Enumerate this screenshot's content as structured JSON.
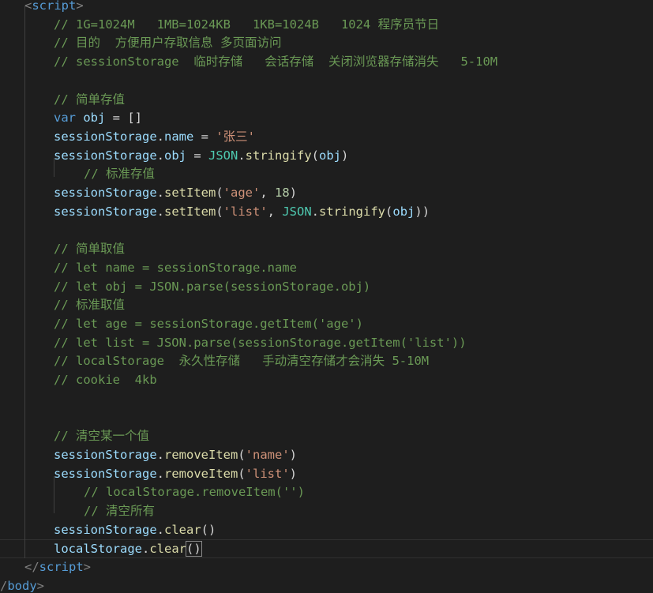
{
  "editor": {
    "lines": [
      {
        "indent": 1,
        "tokens": [
          [
            "t-bracket",
            "<"
          ],
          [
            "t-tag",
            "script"
          ],
          [
            "t-bracket",
            ">"
          ]
        ]
      },
      {
        "indent": 2,
        "tokens": [
          [
            "t-comment",
            "// 1G=1024M   1MB=1024KB   1KB=1024B   1024 程序员节日"
          ]
        ]
      },
      {
        "indent": 2,
        "tokens": [
          [
            "t-comment",
            "// 目的  方便用户存取信息 多页面访问"
          ]
        ]
      },
      {
        "indent": 2,
        "tokens": [
          [
            "t-comment",
            "// sessionStorage  临时存储   会话存储  关闭浏览器存储消失   5-10M"
          ]
        ]
      },
      {
        "indent": 0,
        "tokens": []
      },
      {
        "indent": 2,
        "tokens": [
          [
            "t-comment",
            "// 简单存值"
          ]
        ]
      },
      {
        "indent": 2,
        "tokens": [
          [
            "t-keyword",
            "var"
          ],
          [
            "t-punc",
            " "
          ],
          [
            "t-var",
            "obj"
          ],
          [
            "t-punc",
            " = []"
          ]
        ]
      },
      {
        "indent": 2,
        "tokens": [
          [
            "t-var",
            "sessionStorage"
          ],
          [
            "t-punc",
            "."
          ],
          [
            "t-prop",
            "name"
          ],
          [
            "t-punc",
            " = "
          ],
          [
            "t-str",
            "'张三'"
          ]
        ]
      },
      {
        "indent": 2,
        "tokens": [
          [
            "t-var",
            "sessionStorage"
          ],
          [
            "t-punc",
            "."
          ],
          [
            "t-prop",
            "obj"
          ],
          [
            "t-punc",
            " = "
          ],
          [
            "t-const",
            "JSON"
          ],
          [
            "t-punc",
            "."
          ],
          [
            "t-func",
            "stringify"
          ],
          [
            "t-punc",
            "("
          ],
          [
            "t-var",
            "obj"
          ],
          [
            "t-punc",
            ")"
          ]
        ]
      },
      {
        "indent": 3,
        "tokens": [
          [
            "t-comment",
            "// 标准存值"
          ]
        ]
      },
      {
        "indent": 2,
        "tokens": [
          [
            "t-var",
            "sessionStorage"
          ],
          [
            "t-punc",
            "."
          ],
          [
            "t-func",
            "setItem"
          ],
          [
            "t-punc",
            "("
          ],
          [
            "t-str",
            "'age'"
          ],
          [
            "t-punc",
            ", "
          ],
          [
            "t-num",
            "18"
          ],
          [
            "t-punc",
            ")"
          ]
        ]
      },
      {
        "indent": 2,
        "tokens": [
          [
            "t-var",
            "sessionStorage"
          ],
          [
            "t-punc",
            "."
          ],
          [
            "t-func",
            "setItem"
          ],
          [
            "t-punc",
            "("
          ],
          [
            "t-str",
            "'list'"
          ],
          [
            "t-punc",
            ", "
          ],
          [
            "t-const",
            "JSON"
          ],
          [
            "t-punc",
            "."
          ],
          [
            "t-func",
            "stringify"
          ],
          [
            "t-punc",
            "("
          ],
          [
            "t-var",
            "obj"
          ],
          [
            "t-punc",
            "))"
          ]
        ]
      },
      {
        "indent": 0,
        "tokens": []
      },
      {
        "indent": 2,
        "tokens": [
          [
            "t-comment",
            "// 简单取值"
          ]
        ]
      },
      {
        "indent": 2,
        "tokens": [
          [
            "t-comment",
            "// let name = sessionStorage.name"
          ]
        ]
      },
      {
        "indent": 2,
        "tokens": [
          [
            "t-comment",
            "// let obj = JSON.parse(sessionStorage.obj)"
          ]
        ]
      },
      {
        "indent": 2,
        "tokens": [
          [
            "t-comment",
            "// 标准取值"
          ]
        ]
      },
      {
        "indent": 2,
        "tokens": [
          [
            "t-comment",
            "// let age = sessionStorage.getItem('age')"
          ]
        ]
      },
      {
        "indent": 2,
        "tokens": [
          [
            "t-comment",
            "// let list = JSON.parse(sessionStorage.getItem('list'))"
          ]
        ]
      },
      {
        "indent": 2,
        "tokens": [
          [
            "t-comment",
            "// localStorage  永久性存储   手动清空存储才会消失 5-10M"
          ]
        ]
      },
      {
        "indent": 2,
        "tokens": [
          [
            "t-comment",
            "// cookie  4kb"
          ]
        ]
      },
      {
        "indent": 0,
        "tokens": []
      },
      {
        "indent": 0,
        "tokens": []
      },
      {
        "indent": 2,
        "tokens": [
          [
            "t-comment",
            "// 清空某一个值"
          ]
        ]
      },
      {
        "indent": 2,
        "tokens": [
          [
            "t-var",
            "sessionStorage"
          ],
          [
            "t-punc",
            "."
          ],
          [
            "t-func",
            "removeItem"
          ],
          [
            "t-punc",
            "("
          ],
          [
            "t-str",
            "'name'"
          ],
          [
            "t-punc",
            ")"
          ]
        ]
      },
      {
        "indent": 2,
        "tokens": [
          [
            "t-var",
            "sessionStorage"
          ],
          [
            "t-punc",
            "."
          ],
          [
            "t-func",
            "removeItem"
          ],
          [
            "t-punc",
            "("
          ],
          [
            "t-str",
            "'list'"
          ],
          [
            "t-punc",
            ")"
          ]
        ]
      },
      {
        "indent": 3,
        "tokens": [
          [
            "t-comment",
            "// localStorage.removeItem('')"
          ]
        ]
      },
      {
        "indent": 3,
        "tokens": [
          [
            "t-comment",
            "// 清空所有"
          ]
        ]
      },
      {
        "indent": 2,
        "tokens": [
          [
            "t-var",
            "sessionStorage"
          ],
          [
            "t-punc",
            "."
          ],
          [
            "t-func",
            "clear"
          ],
          [
            "t-punc",
            "()"
          ]
        ]
      },
      {
        "indent": 2,
        "current": true,
        "tokens": [
          [
            "t-var",
            "localStorage"
          ],
          [
            "t-punc",
            "."
          ],
          [
            "t-func",
            "clear"
          ],
          [
            "cursor",
            "()"
          ]
        ]
      },
      {
        "indent": 1,
        "tokens": [
          [
            "t-bracket",
            "</"
          ],
          [
            "t-tag",
            "script"
          ],
          [
            "t-bracket",
            ">"
          ]
        ]
      },
      {
        "indent": 0,
        "tokens": [
          [
            "t-bracket",
            "/"
          ],
          [
            "t-tag",
            "body"
          ],
          [
            "t-bracket",
            ">"
          ]
        ]
      }
    ]
  }
}
